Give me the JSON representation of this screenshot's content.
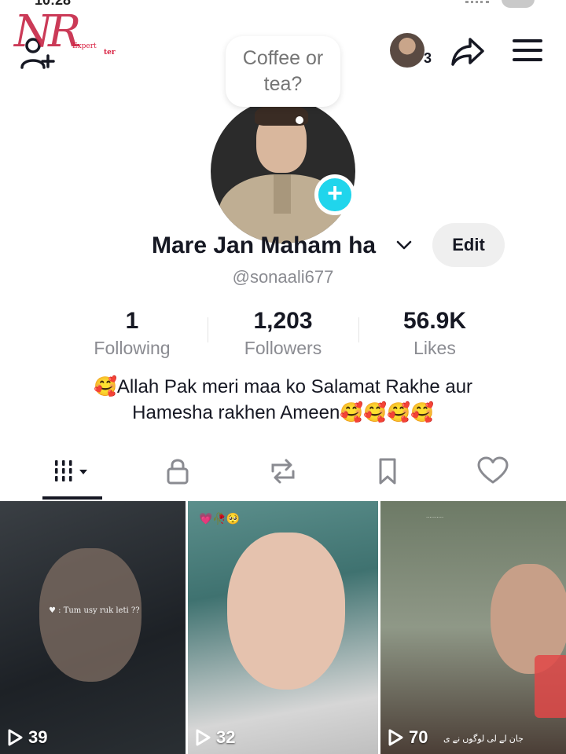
{
  "status_bar": {
    "time_fragment": "10:28"
  },
  "watermark": {
    "letters": "NR",
    "line1": "Expert",
    "line2": "ter"
  },
  "header": {
    "friends_count": "3"
  },
  "note": {
    "line1": "Coffee or",
    "line2": "tea?"
  },
  "profile": {
    "display_name": "Mare Jan Maham ha",
    "username": "@sonaali677",
    "edit_label": "Edit"
  },
  "stats": {
    "following": {
      "value": "1",
      "label": "Following"
    },
    "followers": {
      "value": "1,203",
      "label": "Followers"
    },
    "likes": {
      "value": "56.9K",
      "label": "Likes"
    }
  },
  "bio": {
    "line1_emoji": "🥰",
    "line1": "Allah Pak meri maa ko Salamat Rakhe aur",
    "line2": "Hamesha rakhen Ameen",
    "line2_emoji": "🥰🥰🥰🥰"
  },
  "tabs": [
    {
      "icon": "grid-icon",
      "active": true
    },
    {
      "icon": "lock-icon",
      "active": false
    },
    {
      "icon": "repost-icon",
      "active": false
    },
    {
      "icon": "bookmark-icon",
      "active": false
    },
    {
      "icon": "heart-icon",
      "active": false
    }
  ],
  "videos": [
    {
      "plays": "39",
      "caption": "♥ : Tum usy ruk leti ??"
    },
    {
      "plays": "32",
      "caption": "💗🥀🥺"
    },
    {
      "plays": "70",
      "caption": "جان لے لی لوگوں نے ی"
    }
  ],
  "colors": {
    "accent": "#20d5ec",
    "text": "#161823",
    "secondary": "#8a8b91"
  }
}
